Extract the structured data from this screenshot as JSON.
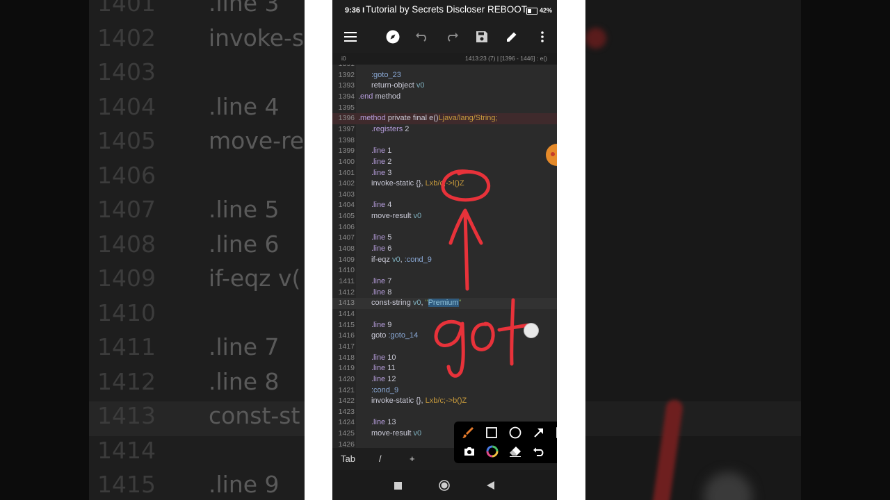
{
  "background": {
    "left_lines": [
      {
        "num": "1401",
        "code": ".line 3"
      },
      {
        "num": "1402",
        "code": "invoke-s"
      },
      {
        "num": "1403",
        "code": ""
      },
      {
        "num": "1404",
        "code": ".line 4"
      },
      {
        "num": "1405",
        "code": "move-re"
      },
      {
        "num": "1406",
        "code": ""
      },
      {
        "num": "1407",
        "code": ".line 5"
      },
      {
        "num": "1408",
        "code": ".line 6"
      },
      {
        "num": "1409",
        "code": "if-eqz v("
      },
      {
        "num": "1410",
        "code": ""
      },
      {
        "num": "1411",
        "code": ".line 7"
      },
      {
        "num": "1412",
        "code": ".line 8"
      },
      {
        "num": "1413",
        "code": "const-st"
      },
      {
        "num": "1414",
        "code": ""
      },
      {
        "num": "1415",
        "code": ".line 9"
      }
    ]
  },
  "status_bar": {
    "time": "9:36 I",
    "video_title": "Tutorial by Secrets Discloser REBOOT",
    "battery": "42%"
  },
  "toolbar": {
    "icons": [
      "menu-icon",
      "compass-icon",
      "undo-icon",
      "redo-icon",
      "save-icon",
      "edit-icon",
      "more-vert-icon"
    ]
  },
  "info_bar": {
    "left": "i0",
    "right": "1413:23 (7)  |  [1396 - 1446] : e()"
  },
  "editor": {
    "lines": [
      {
        "n": "1391",
        "t": ""
      },
      {
        "n": "1392",
        "t": ":goto_23"
      },
      {
        "n": "1393",
        "t": "return-object v0"
      },
      {
        "n": "1394",
        "t": ".end method"
      },
      {
        "n": "1395",
        "t": ""
      },
      {
        "n": "1396",
        "t": ".method private final e()Ljava/lang/String;"
      },
      {
        "n": "1397",
        "t": ".registers 2"
      },
      {
        "n": "1398",
        "t": ""
      },
      {
        "n": "1399",
        "t": ".line 1"
      },
      {
        "n": "1400",
        "t": ".line 2"
      },
      {
        "n": "1401",
        "t": ".line 3"
      },
      {
        "n": "1402",
        "t": "invoke-static {}, Lxb/c;->l()Z"
      },
      {
        "n": "1403",
        "t": ""
      },
      {
        "n": "1404",
        "t": ".line 4"
      },
      {
        "n": "1405",
        "t": "move-result v0"
      },
      {
        "n": "1406",
        "t": ""
      },
      {
        "n": "1407",
        "t": ".line 5"
      },
      {
        "n": "1408",
        "t": ".line 6"
      },
      {
        "n": "1409",
        "t": "if-eqz v0, :cond_9"
      },
      {
        "n": "1410",
        "t": ""
      },
      {
        "n": "1411",
        "t": ".line 7"
      },
      {
        "n": "1412",
        "t": ".line 8"
      },
      {
        "n": "1413",
        "t": "const-string v0, \"Premium\""
      },
      {
        "n": "1414",
        "t": ""
      },
      {
        "n": "1415",
        "t": ".line 9"
      },
      {
        "n": "1416",
        "t": "goto :goto_14"
      },
      {
        "n": "1417",
        "t": ""
      },
      {
        "n": "1418",
        "t": ".line 10"
      },
      {
        "n": "1419",
        "t": ".line 11"
      },
      {
        "n": "1420",
        "t": ".line 12"
      },
      {
        "n": "1421",
        "t": ":cond_9"
      },
      {
        "n": "1422",
        "t": "invoke-static {}, Lxb/c;->b()Z"
      },
      {
        "n": "1423",
        "t": ""
      },
      {
        "n": "1424",
        "t": ".line 13"
      },
      {
        "n": "1425",
        "t": "move-result v0"
      },
      {
        "n": "1426",
        "t": ""
      }
    ]
  },
  "bottom_bar": {
    "tab": "Tab",
    "slash": "/",
    "plus": "+"
  },
  "draw_tools": {
    "row1": [
      "brush-icon",
      "rectangle-icon",
      "circle-icon",
      "arrow-icon",
      "fill-icon"
    ],
    "row2": [
      "camera-icon",
      "color-wheel-icon",
      "eraser-icon",
      "undo-icon",
      "close-icon"
    ]
  },
  "annotation": {
    "handwritten_text": "goto",
    "stroke_color": "#e8323a"
  }
}
